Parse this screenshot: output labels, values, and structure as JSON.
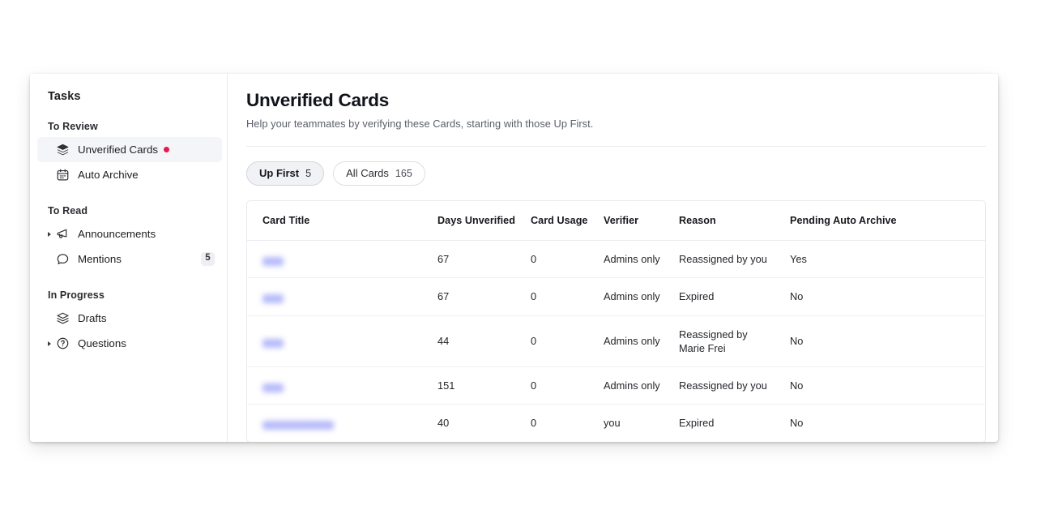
{
  "sidebar": {
    "title": "Tasks",
    "groups": [
      {
        "label": "To Review",
        "items": [
          {
            "label": "Unverified Cards",
            "icon": "layers-icon",
            "active": true,
            "dot": true,
            "caret": false,
            "badge": ""
          },
          {
            "label": "Auto Archive",
            "icon": "calendar-icon",
            "active": false,
            "dot": false,
            "caret": false,
            "badge": ""
          }
        ]
      },
      {
        "label": "To Read",
        "items": [
          {
            "label": "Announcements",
            "icon": "megaphone-icon",
            "active": false,
            "dot": false,
            "caret": true,
            "badge": ""
          },
          {
            "label": "Mentions",
            "icon": "comment-icon",
            "active": false,
            "dot": false,
            "caret": false,
            "badge": "5"
          }
        ]
      },
      {
        "label": "In Progress",
        "items": [
          {
            "label": "Drafts",
            "icon": "layers-outline-icon",
            "active": false,
            "dot": false,
            "caret": false,
            "badge": ""
          },
          {
            "label": "Questions",
            "icon": "question-circle-icon",
            "active": false,
            "dot": false,
            "caret": true,
            "badge": ""
          }
        ]
      }
    ]
  },
  "main": {
    "title": "Unverified Cards",
    "subtitle": "Help your teammates by verifying these Cards, starting with those Up First.",
    "tabs": [
      {
        "label": "Up First",
        "count": "5",
        "active": true
      },
      {
        "label": "All Cards",
        "count": "165",
        "active": false
      }
    ],
    "table": {
      "columns": [
        "Card Title",
        "Days Unverified",
        "Card Usage",
        "Verifier",
        "Reason",
        "Pending Auto Archive"
      ],
      "rows": [
        {
          "title": "",
          "title_redacted_width": 26,
          "days": "67",
          "usage": "0",
          "verifier": "Admins only",
          "reason": "Reassigned by you",
          "pending": "Yes"
        },
        {
          "title": "",
          "title_redacted_width": 26,
          "days": "67",
          "usage": "0",
          "verifier": "Admins only",
          "reason": "Expired",
          "pending": "No"
        },
        {
          "title": "",
          "title_redacted_width": 26,
          "days": "44",
          "usage": "0",
          "verifier": "Admins only",
          "reason": "Reassigned by\nMarie Frei",
          "pending": "No"
        },
        {
          "title": "",
          "title_redacted_width": 26,
          "days": "151",
          "usage": "0",
          "verifier": "Admins only",
          "reason": "Reassigned by you",
          "pending": "No"
        },
        {
          "title": "",
          "title_redacted_width": 88,
          "days": "40",
          "usage": "0",
          "verifier": "you",
          "reason": "Expired",
          "pending": "No"
        }
      ]
    }
  },
  "colors": {
    "accent_dot": "#e8184c",
    "redacted_link": "#7b82f5",
    "active_tab_bg": "#f1f2f5",
    "sidebar_active_bg": "#f4f5f8"
  }
}
